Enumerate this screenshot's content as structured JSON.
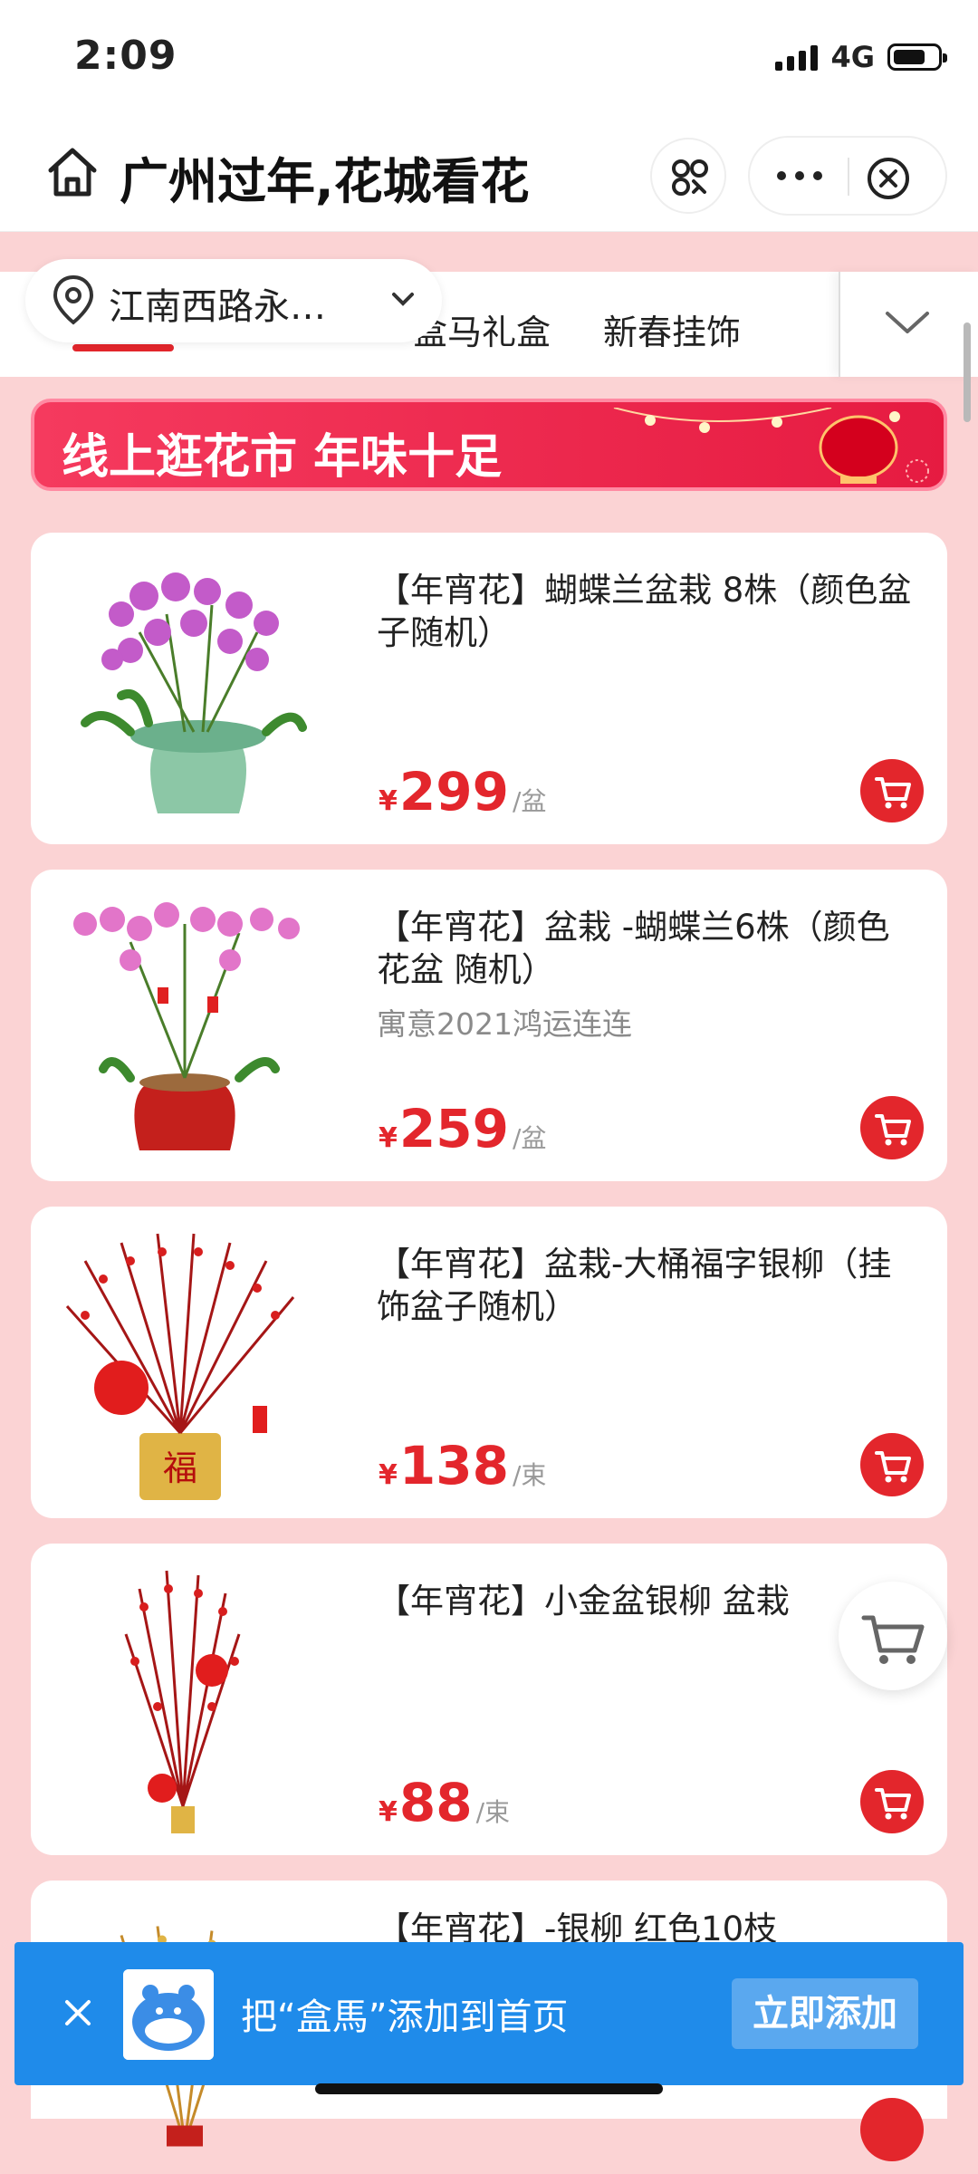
{
  "status": {
    "time": "2:09",
    "network": "4G",
    "battery_level": 0.72
  },
  "nav": {
    "title": "广州过年,花城看花"
  },
  "location": {
    "text": "江南西路永…"
  },
  "tabs": [
    {
      "label": "盒马礼盒"
    },
    {
      "label": "新春挂饰"
    }
  ],
  "banner": {
    "text": "线上逛花市 年味十足"
  },
  "products": [
    {
      "title": "【年宵花】蝴蝶兰盆栽 8株（颜色盆子随机）",
      "subtitle": "",
      "yen": "¥",
      "price": "299",
      "unit": "/盆"
    },
    {
      "title": "【年宵花】盆栽 -蝴蝶兰6株（颜色 花盆 随机）",
      "subtitle": "寓意2021鸿运连连",
      "yen": "¥",
      "price": "259",
      "unit": "/盆"
    },
    {
      "title": "【年宵花】盆栽-大桶福字银柳（挂饰盆子随机）",
      "subtitle": "",
      "yen": "¥",
      "price": "138",
      "unit": "/束"
    },
    {
      "title": "【年宵花】小金盆银柳 盆栽",
      "subtitle": "",
      "yen": "¥",
      "price": "88",
      "unit": "/束"
    },
    {
      "title": "【年宵花】-银柳 红色10枝",
      "subtitle": "",
      "yen": "",
      "price": "",
      "unit": ""
    }
  ],
  "add_to_home": {
    "text": "把“盒馬”添加到首页",
    "button": "立即添加"
  },
  "colors": {
    "accent": "#e3262c",
    "page_bg": "#fbd3d4",
    "add_banner": "#1f8bea"
  }
}
